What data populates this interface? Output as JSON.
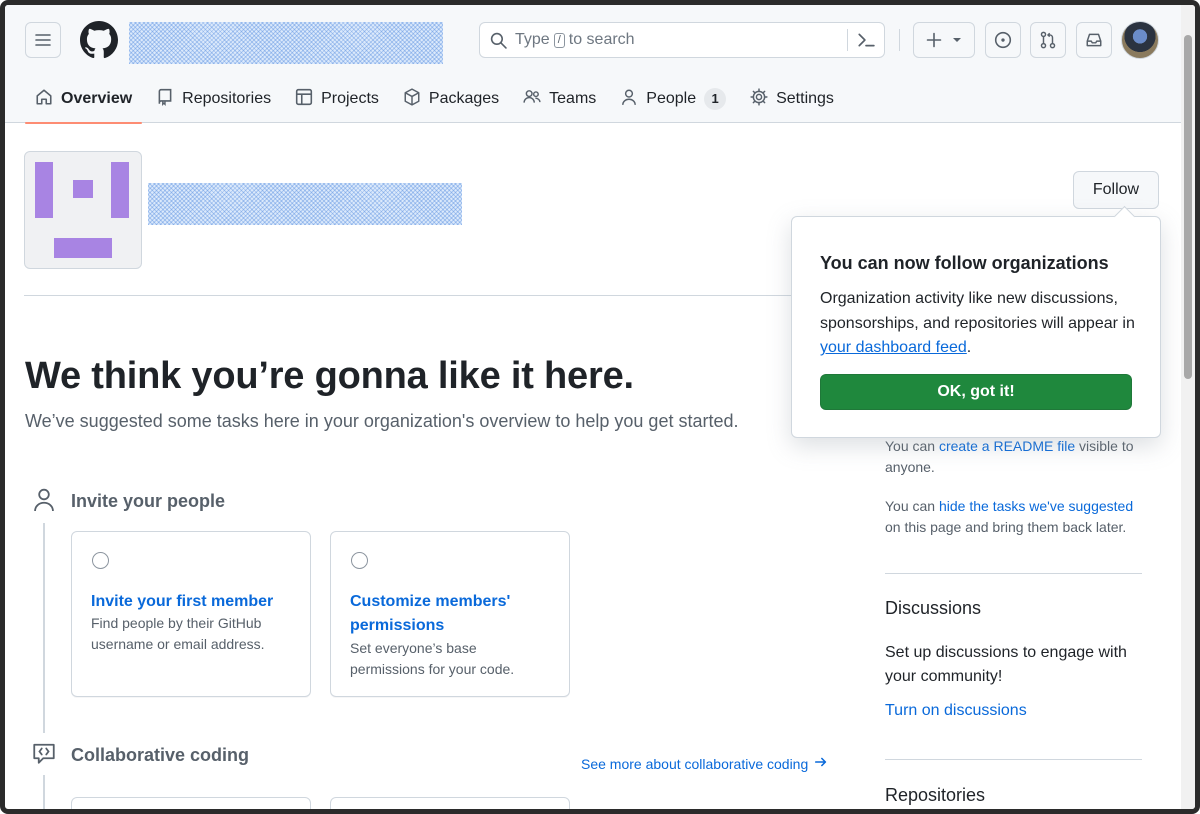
{
  "header": {
    "menu_icon": "hamburger-icon",
    "logo_icon": "github-logo-icon",
    "search": {
      "placeholder_prefix": "Type",
      "shortcut_key": "/",
      "placeholder_suffix": "to search"
    },
    "command_palette_icon": "terminal-icon",
    "create_icon": "plus-icon",
    "issues_icon": "issue-opened-icon",
    "pulls_icon": "git-pull-request-icon",
    "inbox_icon": "inbox-icon"
  },
  "tabs": [
    {
      "label": "Overview",
      "icon": "home-icon",
      "active": true
    },
    {
      "label": "Repositories",
      "icon": "repo-icon"
    },
    {
      "label": "Projects",
      "icon": "table-icon"
    },
    {
      "label": "Packages",
      "icon": "package-icon"
    },
    {
      "label": "Teams",
      "icon": "people-icon"
    },
    {
      "label": "People",
      "icon": "person-icon",
      "count": "1"
    },
    {
      "label": "Settings",
      "icon": "gear-icon"
    }
  ],
  "org": {
    "follow_label": "Follow"
  },
  "hero": {
    "title": "We think you’re gonna like it here.",
    "subtitle": "We’ve suggested some tasks here in your organization's overview to help you get started."
  },
  "sections": {
    "invite": {
      "title": "Invite your people",
      "cards": [
        {
          "title": "Invite your first member",
          "desc": "Find people by their GitHub username or email address."
        },
        {
          "title": "Customize members' permissions",
          "desc": "Set everyone’s base permissions for your code."
        }
      ]
    },
    "collab": {
      "title": "Collaborative coding",
      "see_more": "See more about collaborative coding"
    }
  },
  "right": {
    "readme_prefix": "You can ",
    "readme_link": "create a README file",
    "readme_suffix": " visible to anyone.",
    "hide_prefix": "You can ",
    "hide_link": "hide the tasks we've suggested",
    "hide_suffix": " on this page and bring them back later.",
    "discussions_heading": "Discussions",
    "discussions_text": "Set up discussions to engage with your community!",
    "discussions_link": "Turn on discussions",
    "repositories_heading": "Repositories"
  },
  "popover": {
    "title": "You can now follow organizations",
    "body_prefix": "Organization activity like new discussions, sponsorships, and repositories will appear in ",
    "body_link": "your dashboard feed",
    "body_suffix": ".",
    "button": "OK, got it!"
  },
  "colors": {
    "accent": "#0969da",
    "primary_button": "#1f883d",
    "tab_underline": "#fd8c73",
    "avatar_purple": "#a884e3"
  }
}
